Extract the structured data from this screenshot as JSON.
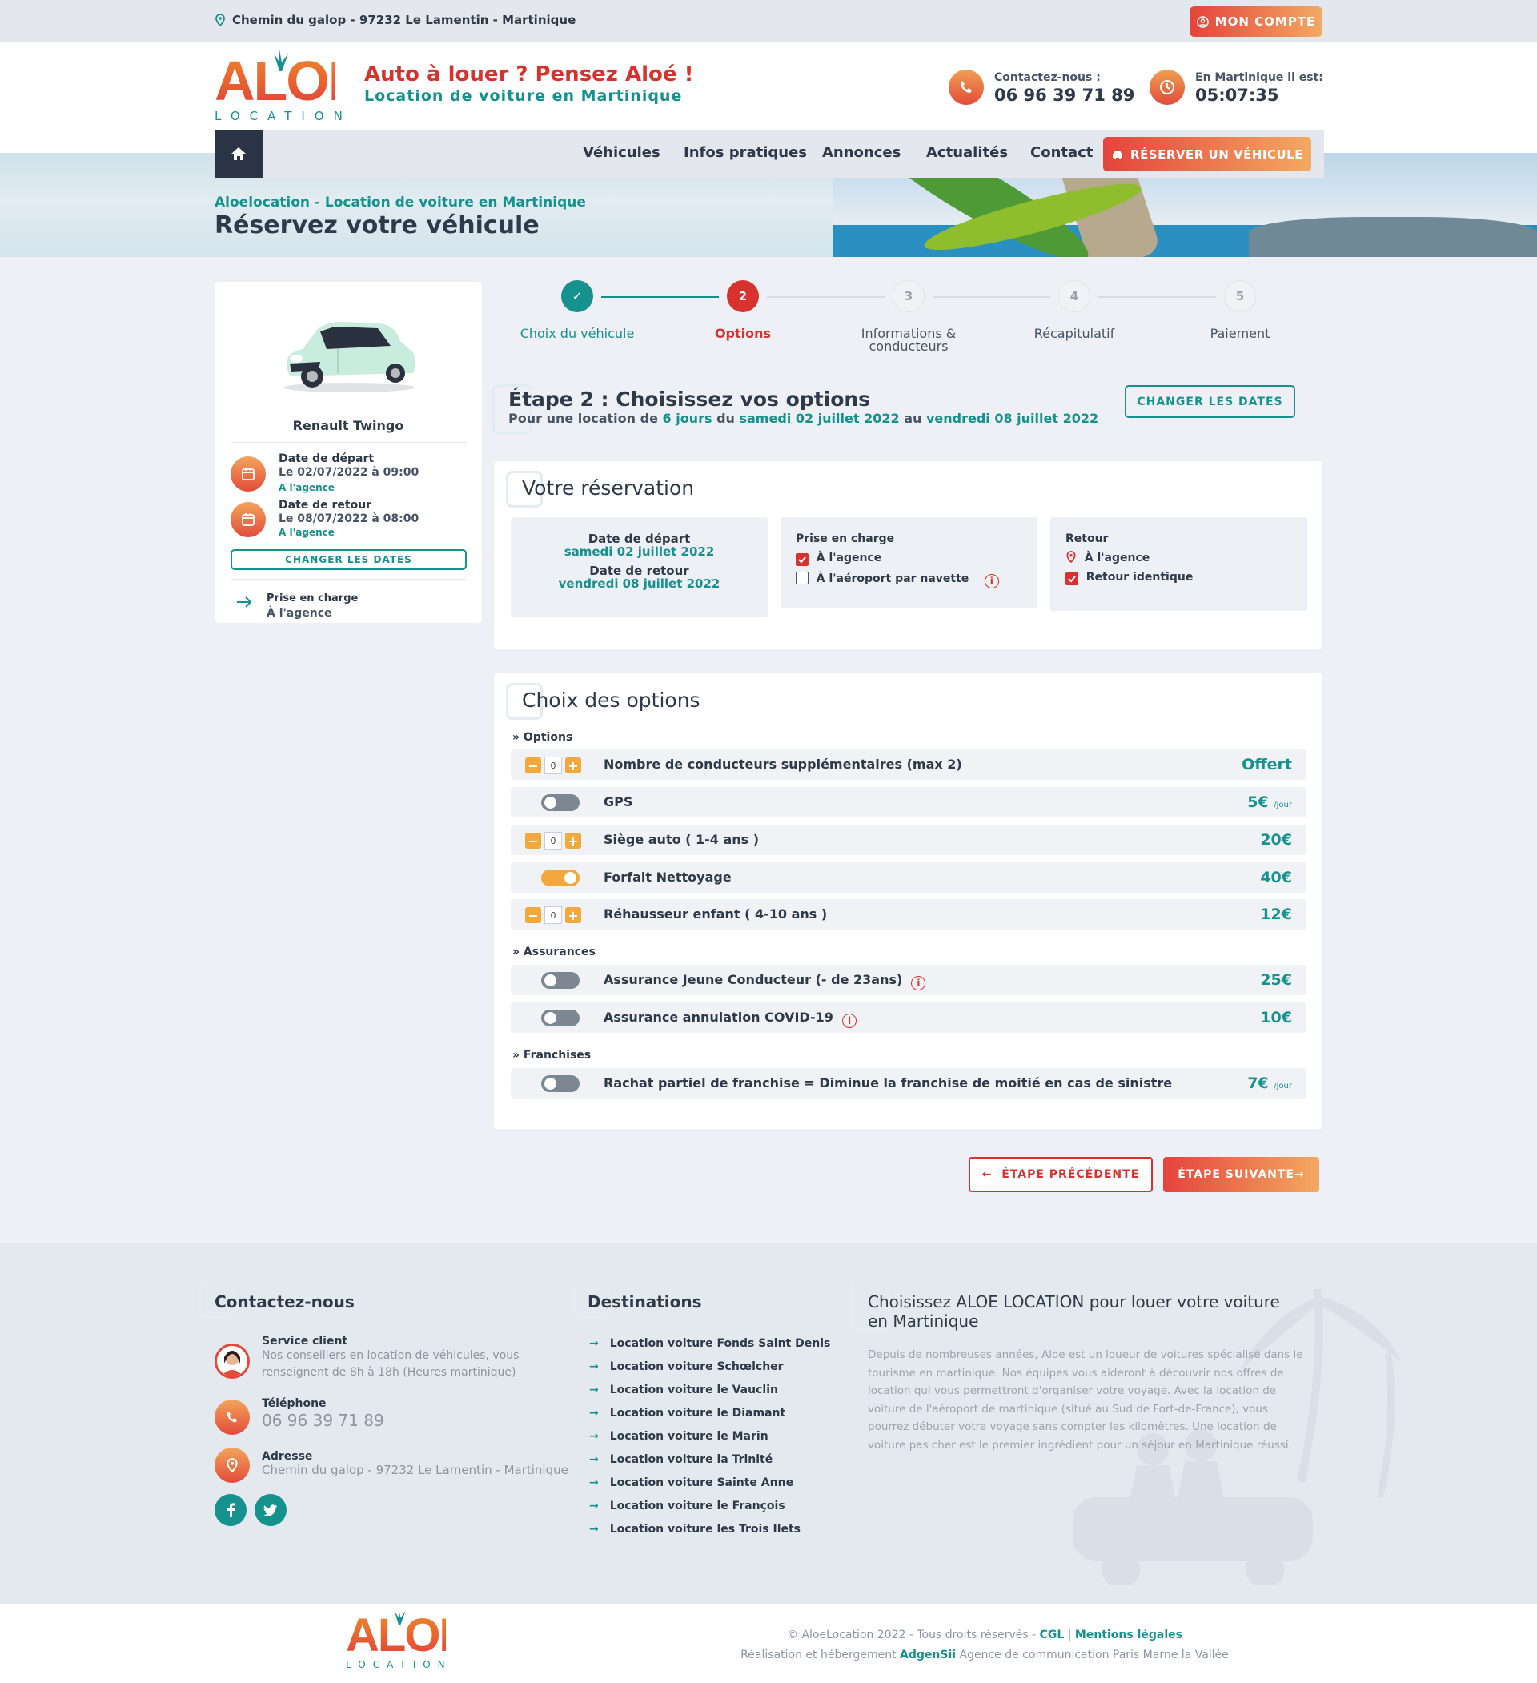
{
  "topbar": {
    "address": "Chemin du galop - 97232 Le Lamentin - Martinique",
    "account_label": "MON COMPTE"
  },
  "header": {
    "logo_word": "ALOE",
    "logo_sub": "LOCATION",
    "slogan_main": "Auto à louer ? Pensez Aloé !",
    "slogan_sub": "Location de voiture en Martinique",
    "contact_label": "Contactez-nous :",
    "contact_phone": "06 96 39 71 89",
    "time_label": "En Martinique il est:",
    "time_value": "05:07:35"
  },
  "nav": {
    "items": [
      "Véhicules",
      "Infos pratiques",
      "Annonces",
      "Actualités",
      "Contact"
    ],
    "reserve_label": "RÉSERVER UN VÉHICULE"
  },
  "banner": {
    "breadcrumb": "Aloelocation - Location de voiture en Martinique",
    "title": "Réservez votre véhicule"
  },
  "sidebar": {
    "car_name": "Renault Twingo",
    "depart_label": "Date de départ",
    "depart_value": "Le 02/07/2022 à 09:00",
    "depart_place": "A l'agence",
    "return_label": "Date de retour",
    "return_value": "Le 08/07/2022 à 08:00",
    "return_place": "A l'agence",
    "change_dates": "CHANGER LES DATES",
    "pickup_label": "Prise en charge",
    "pickup_value": "À l'agence"
  },
  "steps": [
    {
      "num": "✓",
      "label": "Choix du véhicule",
      "state": "done"
    },
    {
      "num": "2",
      "label": "Options",
      "state": "active"
    },
    {
      "num": "3",
      "label": "Informations & conducteurs",
      "state": "todo"
    },
    {
      "num": "4",
      "label": "Récapitulatif",
      "state": "todo"
    },
    {
      "num": "5",
      "label": "Paiement",
      "state": "todo"
    }
  ],
  "step_heading": {
    "title": "Étape 2 : Choisissez vos options",
    "sub_prefix": "Pour une location de",
    "sub_days": "6 jours",
    "sub_du": "du",
    "sub_start": "samedi 02 juillet 2022",
    "sub_au": "au",
    "sub_end": "vendredi 08 juillet 2022",
    "change_dates": "CHANGER LES DATES"
  },
  "reservation": {
    "title": "Votre réservation",
    "depart_label": "Date de départ",
    "depart_value": "samedi 02 juillet 2022",
    "return_label": "Date de retour",
    "return_value": "vendredi 08 juillet 2022",
    "pickup_title": "Prise en charge",
    "pickup_opt1": "À l'agence",
    "pickup_opt2": "À l'aéroport par navette",
    "return_title": "Retour",
    "return_place": "À l'agence",
    "return_same": "Retour identique"
  },
  "options": {
    "title": "Choix des options",
    "group_options": "Options",
    "group_assurances": "Assurances",
    "group_franchises": "Franchises",
    "per_day": "/jour",
    "rows": [
      {
        "label": "Nombre de conducteurs supplémentaires (max 2)",
        "price": "Offert",
        "qty": "0"
      },
      {
        "label": "GPS",
        "price": "5€"
      },
      {
        "label": "Siège auto ( 1-4 ans )",
        "price": "20€",
        "qty": "0"
      },
      {
        "label": "Forfait Nettoyage",
        "price": "40€"
      },
      {
        "label": "Réhausseur enfant ( 4-10 ans )",
        "price": "12€",
        "qty": "0"
      },
      {
        "label": "Assurance Jeune Conducteur (- de 23ans)",
        "price": "25€"
      },
      {
        "label": "Assurance annulation COVID-19",
        "price": "10€"
      },
      {
        "label": "Rachat partiel de franchise = Diminue la franchise de moitié en cas de sinistre",
        "price": "7€"
      }
    ]
  },
  "buttons": {
    "prev": "ÉTAPE PRÉCÉDENTE",
    "next": "ÉTAPE SUIVANTE"
  },
  "footer": {
    "contact_title": "Contactez-nous",
    "service_label": "Service client",
    "service_text1": "Nos conseillers en location de véhicules, vous",
    "service_text2": "renseignent de 8h à 18h (Heures martinique)",
    "phone_label": "Téléphone",
    "phone_value": "06 96 39 71 89",
    "address_label": "Adresse",
    "address_value": "Chemin du galop - 97232 Le Lamentin - Martinique",
    "dest_title": "Destinations",
    "destinations": [
      "Location voiture Fonds Saint Denis",
      "Location voiture Schœlcher",
      "Location voiture le Vauclin",
      "Location voiture le Diamant",
      "Location voiture le Marin",
      "Location voiture la Trinité",
      "Location voiture Sainte Anne",
      "Location voiture le François",
      "Location voiture les Trois Ilets"
    ],
    "about_title1": "Choisissez ALOE LOCATION pour louer votre voiture",
    "about_title2": "en Martinique",
    "about_lines": [
      "Depuis de nombreuses années, Aloe est un loueur de voitures spécialisé dans le",
      "tourisme en martinique. Nos équipes vous aideront à découvrir nos offres de",
      "location qui vous permettront d'organiser votre voyage. Avec la location de",
      "voiture de l'aéroport de martinique (situé au Sud de Fort-de-France), vous",
      "pourrez débuter votre voyage sans compter les kilomètres. Une location de",
      "voiture pas cher est le premier ingrédient pour un séjour en Martinique réussi."
    ]
  },
  "bottom": {
    "copyright": "© AloeLocation 2022 - Tous droits réservés -",
    "cgl": "CGL",
    "sep": "|",
    "mentions": "Mentions légales",
    "realisation": "Réalisation et hébergement",
    "agency": "AdgenSii",
    "agency_desc": "Agence de communication Paris Marne la Vallée"
  }
}
